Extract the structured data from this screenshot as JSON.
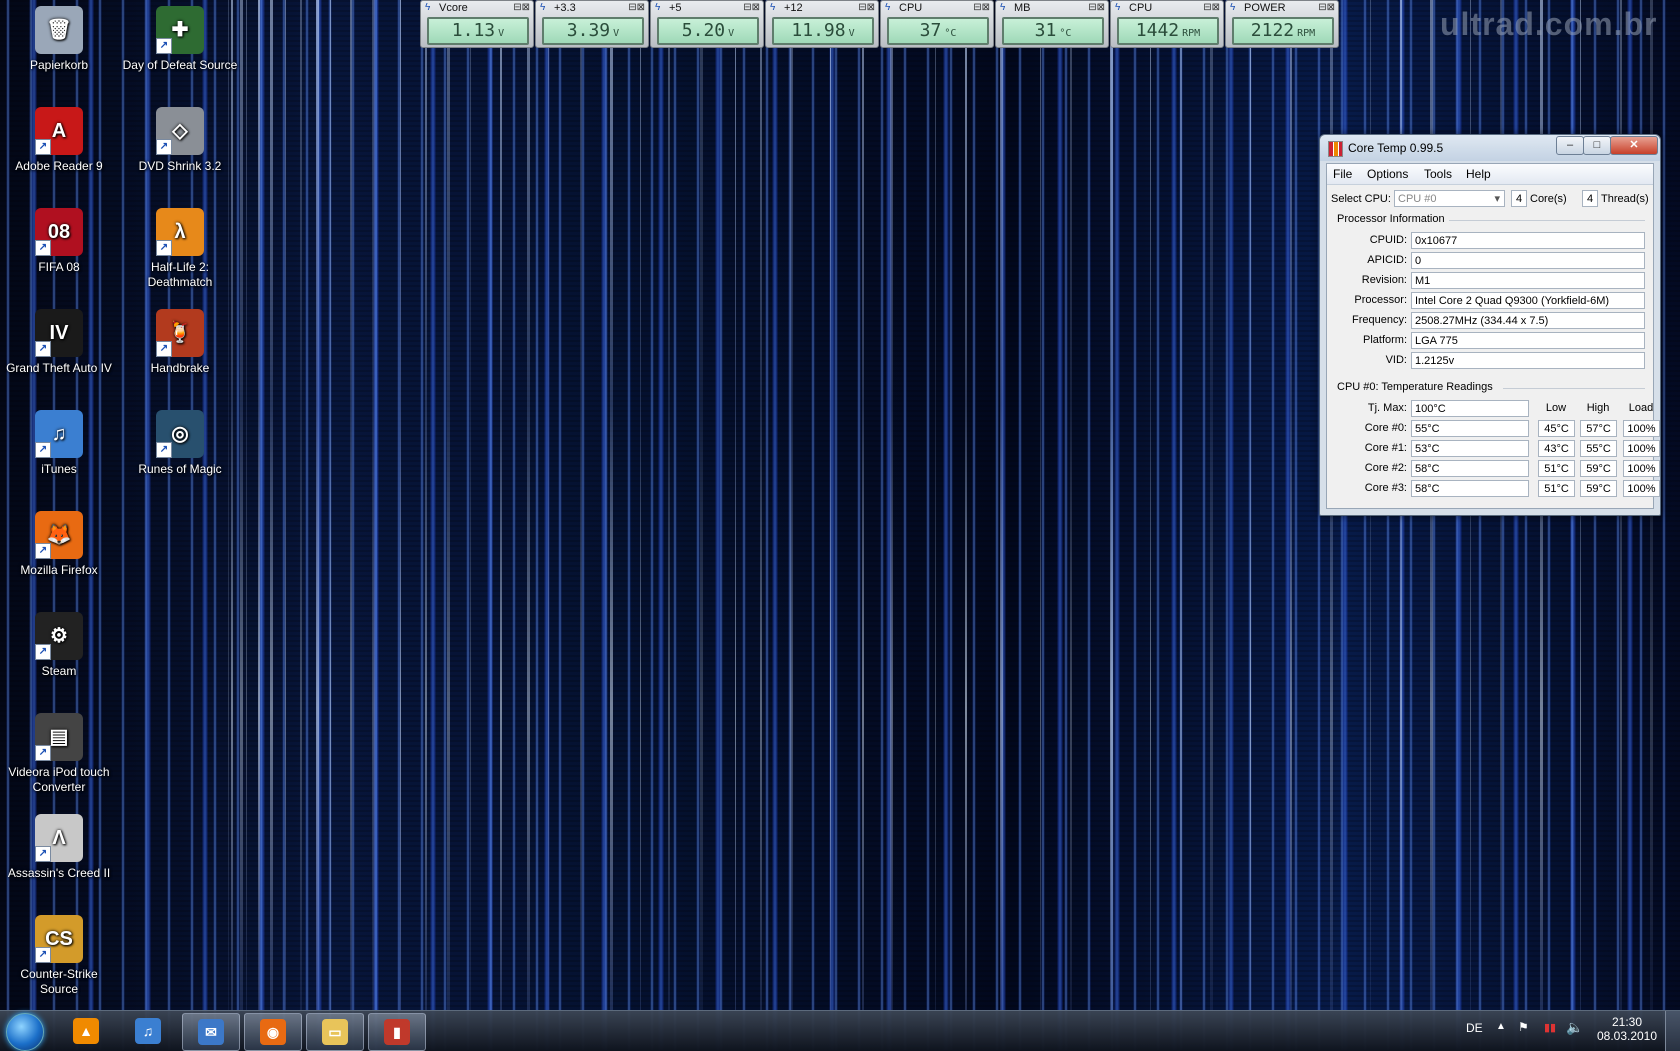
{
  "watermark": "ultrad.com.br",
  "desktop_icons": [
    {
      "label": "Papierkorb",
      "icon": "recycle-bin-icon",
      "color": "#9aa7b8",
      "glyph": "🗑"
    },
    {
      "label": "Adobe Reader 9",
      "icon": "adobe-reader-icon",
      "color": "#c81818",
      "glyph": "A"
    },
    {
      "label": "FIFA 08",
      "icon": "fifa-icon",
      "color": "#b01020",
      "glyph": "08"
    },
    {
      "label": "Grand Theft Auto IV",
      "icon": "gta-icon",
      "color": "#1a1a1a",
      "glyph": "IV"
    },
    {
      "label": "iTunes",
      "icon": "itunes-icon",
      "color": "#3b7fd1",
      "glyph": "♫"
    },
    {
      "label": "Mozilla Firefox",
      "icon": "firefox-icon",
      "color": "#e86a12",
      "glyph": "🦊"
    },
    {
      "label": "Steam",
      "icon": "steam-icon",
      "color": "#222",
      "glyph": "⚙"
    },
    {
      "label": "Videora iPod touch Converter",
      "icon": "videora-icon",
      "color": "#444",
      "glyph": "▤"
    },
    {
      "label": "Assassin's Creed II",
      "icon": "assassins-creed-icon",
      "color": "#c8c8c8",
      "glyph": "Λ"
    },
    {
      "label": "Counter-Strike Source",
      "icon": "counter-strike-icon",
      "color": "#d39b2a",
      "glyph": "CS"
    },
    {
      "label": "Day of Defeat Source",
      "icon": "day-of-defeat-icon",
      "color": "#2e6b32",
      "glyph": "✚"
    },
    {
      "label": "DVD Shrink 3.2",
      "icon": "dvd-shrink-icon",
      "color": "#8a8f96",
      "glyph": "◇"
    },
    {
      "label": "Half-Life 2: Deathmatch",
      "icon": "half-life-icon",
      "color": "#e7891a",
      "glyph": "λ"
    },
    {
      "label": "Handbrake",
      "icon": "handbrake-icon",
      "color": "#b23a1e",
      "glyph": "🍹"
    },
    {
      "label": "Runes of Magic",
      "icon": "runes-of-magic-icon",
      "color": "#28506e",
      "glyph": "◎"
    }
  ],
  "gadgets": [
    {
      "title": "Vcore",
      "value": "1.13",
      "unit": "V"
    },
    {
      "title": "+3.3",
      "value": "3.39",
      "unit": "V"
    },
    {
      "title": "+5",
      "value": "5.20",
      "unit": "V"
    },
    {
      "title": "+12",
      "value": "11.98",
      "unit": "V"
    },
    {
      "title": "CPU",
      "value": "37",
      "unit": "°C"
    },
    {
      "title": "MB",
      "value": "31",
      "unit": "°C"
    },
    {
      "title": "CPU",
      "value": "1442",
      "unit": "RPM"
    },
    {
      "title": "POWER",
      "value": "2122",
      "unit": "RPM"
    }
  ],
  "coretemp": {
    "title": "Core Temp 0.99.5",
    "menu": [
      "File",
      "Options",
      "Tools",
      "Help"
    ],
    "select_cpu_label": "Select CPU:",
    "select_cpu_value": "CPU #0",
    "cores_count": "4",
    "cores_label": "Core(s)",
    "threads_count": "4",
    "threads_label": "Thread(s)",
    "processor_info_title": "Processor Information",
    "info": [
      {
        "label": "CPUID:",
        "value": "0x10677"
      },
      {
        "label": "APICID:",
        "value": "0"
      },
      {
        "label": "Revision:",
        "value": "M1"
      },
      {
        "label": "Processor:",
        "value": "Intel Core 2 Quad Q9300 (Yorkfield-6M)"
      },
      {
        "label": "Frequency:",
        "value": "2508.27MHz (334.44 x 7.5)"
      },
      {
        "label": "Platform:",
        "value": "LGA 775"
      },
      {
        "label": "VID:",
        "value": "1.2125v"
      }
    ],
    "temp_title": "CPU #0: Temperature Readings",
    "tj_label": "Tj. Max:",
    "tj_value": "100°C",
    "col_low": "Low",
    "col_high": "High",
    "col_load": "Load",
    "cores": [
      {
        "label": "Core #0:",
        "temp": "55°C",
        "low": "45°C",
        "high": "57°C",
        "load": "100%"
      },
      {
        "label": "Core #1:",
        "temp": "53°C",
        "low": "43°C",
        "high": "55°C",
        "load": "100%"
      },
      {
        "label": "Core #2:",
        "temp": "58°C",
        "low": "51°C",
        "high": "59°C",
        "load": "100%"
      },
      {
        "label": "Core #3:",
        "temp": "58°C",
        "low": "51°C",
        "high": "59°C",
        "load": "100%"
      }
    ]
  },
  "taskbar": {
    "apps": [
      {
        "icon": "vlc-icon",
        "color": "#f08a00",
        "glyph": "▲"
      },
      {
        "icon": "itunes-icon",
        "color": "#3b7fd1",
        "glyph": "♫"
      },
      {
        "icon": "messenger-icon",
        "color": "#3c78c8",
        "glyph": "✉"
      },
      {
        "icon": "firefox-icon",
        "color": "#e86a12",
        "glyph": "◉"
      },
      {
        "icon": "explorer-icon",
        "color": "#e8c45a",
        "glyph": "▭"
      },
      {
        "icon": "coretemp-icon",
        "color": "#c0392b",
        "glyph": "▮"
      }
    ],
    "language": "DE",
    "time": "21:30",
    "date": "08.03.2010"
  }
}
